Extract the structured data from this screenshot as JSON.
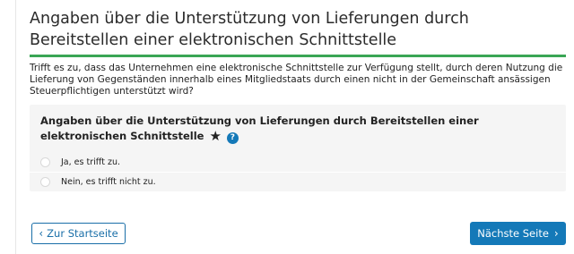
{
  "page": {
    "title": "Angaben über die Unterstützung von Lieferungen durch Bereitstellen einer elektronischen Schnittstelle",
    "description": "Trifft es zu, dass das Unternehmen eine elektronische Schnittstelle zur Verfügung stellt, durch deren Nutzung die Lieferung von Gegenständen innerhalb eines Mitgliedstaats durch einen nicht in der Gemeinschaft ansässigen Steuerpflichtigen unterstützt wird?"
  },
  "question": {
    "label": "Angaben über die Unterstützung von Lieferungen durch Bereitstellen einer elektronischen Schnittstelle",
    "required_marker": "★",
    "help_icon": "?",
    "options": [
      {
        "label": "Ja, es trifft zu.",
        "selected": false
      },
      {
        "label": "Nein, es trifft nicht zu.",
        "selected": false
      }
    ]
  },
  "navigation": {
    "back_label": "Zur Startseite",
    "back_icon": "‹",
    "next_label": "Nächste Seite",
    "next_icon": "›"
  },
  "colors": {
    "accent_green": "#3aa655",
    "primary_blue": "#1479b8",
    "card_bg": "#f5f5f5"
  }
}
